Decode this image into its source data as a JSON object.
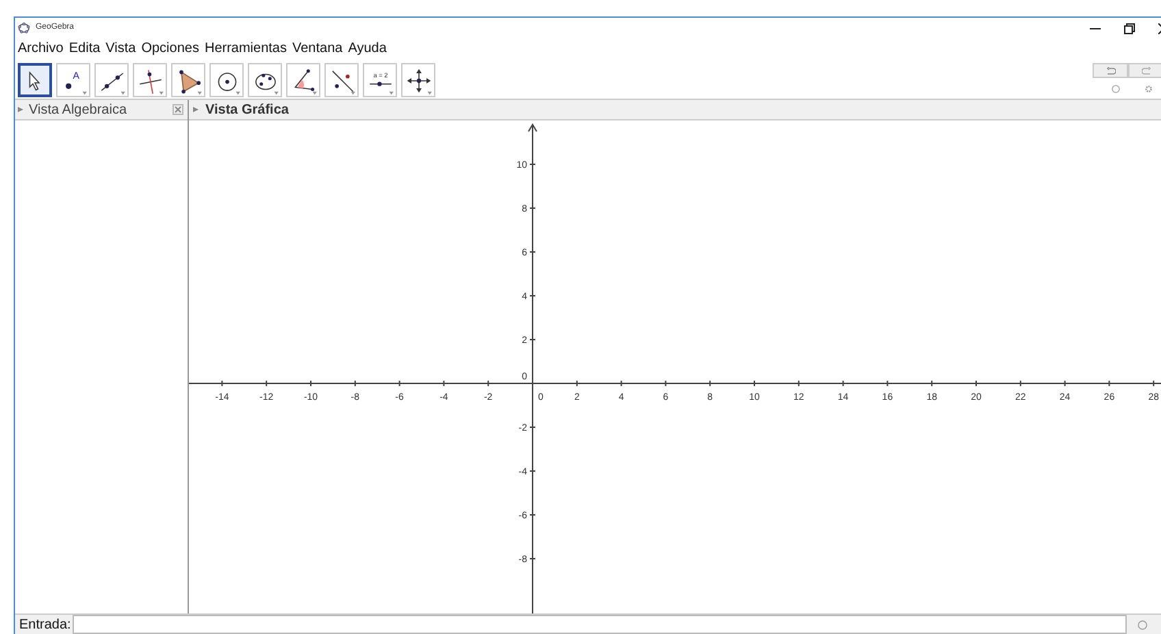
{
  "window": {
    "title": "GeoGebra"
  },
  "menu": [
    "Archivo",
    "Edita",
    "Vista",
    "Opciones",
    "Herramientas",
    "Ventana",
    "Ayuda"
  ],
  "tools": [
    {
      "kind": "move",
      "selected": true
    },
    {
      "kind": "point",
      "selected": false
    },
    {
      "kind": "line",
      "selected": false
    },
    {
      "kind": "perpendicular",
      "selected": false
    },
    {
      "kind": "polygon",
      "selected": false
    },
    {
      "kind": "circle",
      "selected": false
    },
    {
      "kind": "conic",
      "selected": false
    },
    {
      "kind": "angle",
      "selected": false
    },
    {
      "kind": "reflect",
      "selected": false
    },
    {
      "kind": "slider",
      "selected": false
    },
    {
      "kind": "pan",
      "selected": false
    }
  ],
  "tool_labels": {
    "point": "A",
    "slider": "a = 2"
  },
  "algebra_view": {
    "title": "Vista Algebraica"
  },
  "graphics_view": {
    "title": "Vista Gráfica",
    "x_tick_labels": [
      "-14",
      "-12",
      "-10",
      "-8",
      "-6",
      "-4",
      "-2",
      "0",
      "2",
      "4",
      "6",
      "8",
      "10",
      "12",
      "14",
      "16",
      "18",
      "20",
      "22",
      "24",
      "26",
      "28"
    ],
    "y_tick_labels": [
      "10",
      "8",
      "6",
      "4",
      "2",
      "0",
      "-2",
      "-4",
      "-6",
      "-8"
    ]
  },
  "input_bar": {
    "label": "Entrada:"
  }
}
